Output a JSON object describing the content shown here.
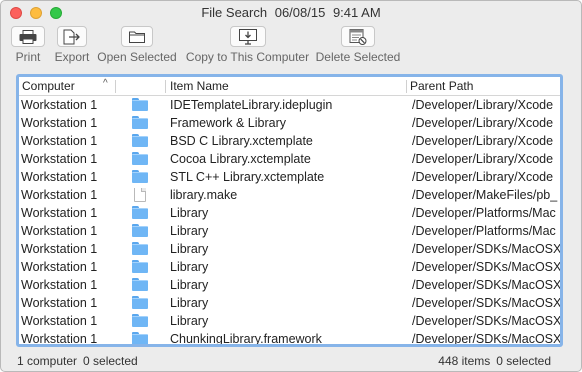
{
  "window": {
    "title": "File Search",
    "date": "06/08/15",
    "time": "9:41 AM"
  },
  "toolbar": {
    "print": {
      "label": "Print",
      "icon": "printer-icon"
    },
    "export": {
      "label": "Export",
      "icon": "export-icon"
    },
    "open_selected": {
      "label": "Open Selected",
      "icon": "folder-open-icon"
    },
    "copy_to_computer": {
      "label": "Copy to This Computer",
      "icon": "monitor-download-icon"
    },
    "delete_selected": {
      "label": "Delete Selected",
      "icon": "delete-icon"
    }
  },
  "table": {
    "columns": {
      "computer": "Computer",
      "item_name": "Item Name",
      "parent_path": "Parent Path"
    },
    "sort_indicator": "^",
    "rows": [
      {
        "computer": "Workstation 1",
        "icon": "folder",
        "name": "IDETemplateLibrary.ideplugin",
        "path": "/Developer/Library/Xcode"
      },
      {
        "computer": "Workstation 1",
        "icon": "folder",
        "name": "Framework & Library",
        "path": "/Developer/Library/Xcode"
      },
      {
        "computer": "Workstation 1",
        "icon": "folder",
        "name": "BSD C Library.xctemplate",
        "path": "/Developer/Library/Xcode"
      },
      {
        "computer": "Workstation 1",
        "icon": "folder",
        "name": "Cocoa Library.xctemplate",
        "path": "/Developer/Library/Xcode"
      },
      {
        "computer": "Workstation 1",
        "icon": "folder",
        "name": "STL C++ Library.xctemplate",
        "path": "/Developer/Library/Xcode"
      },
      {
        "computer": "Workstation 1",
        "icon": "document",
        "name": "library.make",
        "path": "/Developer/MakeFiles/pb_"
      },
      {
        "computer": "Workstation 1",
        "icon": "folder",
        "name": "Library",
        "path": "/Developer/Platforms/Mac"
      },
      {
        "computer": "Workstation 1",
        "icon": "folder",
        "name": "Library",
        "path": "/Developer/Platforms/Mac"
      },
      {
        "computer": "Workstation 1",
        "icon": "folder",
        "name": "Library",
        "path": "/Developer/SDKs/MacOSX"
      },
      {
        "computer": "Workstation 1",
        "icon": "folder",
        "name": "Library",
        "path": "/Developer/SDKs/MacOSX"
      },
      {
        "computer": "Workstation 1",
        "icon": "folder",
        "name": "Library",
        "path": "/Developer/SDKs/MacOSX"
      },
      {
        "computer": "Workstation 1",
        "icon": "folder",
        "name": "Library",
        "path": "/Developer/SDKs/MacOSX"
      },
      {
        "computer": "Workstation 1",
        "icon": "folder",
        "name": "Library",
        "path": "/Developer/SDKs/MacOSX"
      },
      {
        "computer": "Workstation 1",
        "icon": "folder",
        "name": "ChunkingLibrary.framework",
        "path": "/Developer/SDKs/MacOSX"
      }
    ]
  },
  "status": {
    "computers": "1 computer",
    "selected_left": "0 selected",
    "items": "448 items",
    "selected_right": "0 selected"
  },
  "colors": {
    "focus_ring": "#86b4e9",
    "folder": "#6fb6f5",
    "close": "#fc605c",
    "minimize": "#fdbc40",
    "zoom": "#34c84a"
  }
}
